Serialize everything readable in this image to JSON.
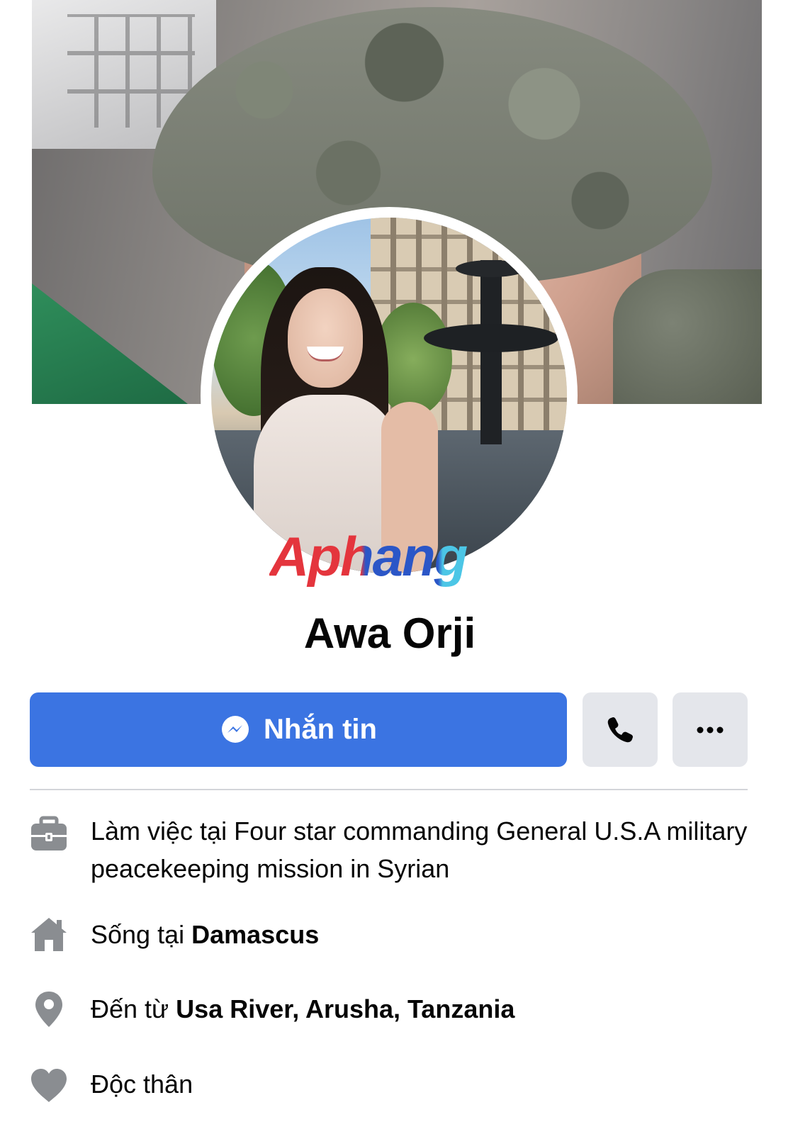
{
  "profile": {
    "name": "Awa Orji"
  },
  "watermark": {
    "text": "Aphang"
  },
  "actions": {
    "message_label": "Nhắn tin",
    "call_icon": "phone-icon",
    "more_icon": "more-dots-icon",
    "message_icon": "messenger-icon",
    "accent_color": "#3b74e2"
  },
  "about": {
    "work": {
      "icon": "briefcase-icon",
      "prefix": "Làm việc tại",
      "value": "Four star commanding General U.S.A military peacekeeping mission in Syrian"
    },
    "lives": {
      "icon": "home-icon",
      "prefix": "Sống tại",
      "value": "Damascus"
    },
    "from": {
      "icon": "location-pin-icon",
      "prefix": "Đến từ",
      "value": "Usa River, Arusha, Tanzania"
    },
    "relationship": {
      "icon": "heart-icon",
      "value": "Độc thân"
    }
  }
}
